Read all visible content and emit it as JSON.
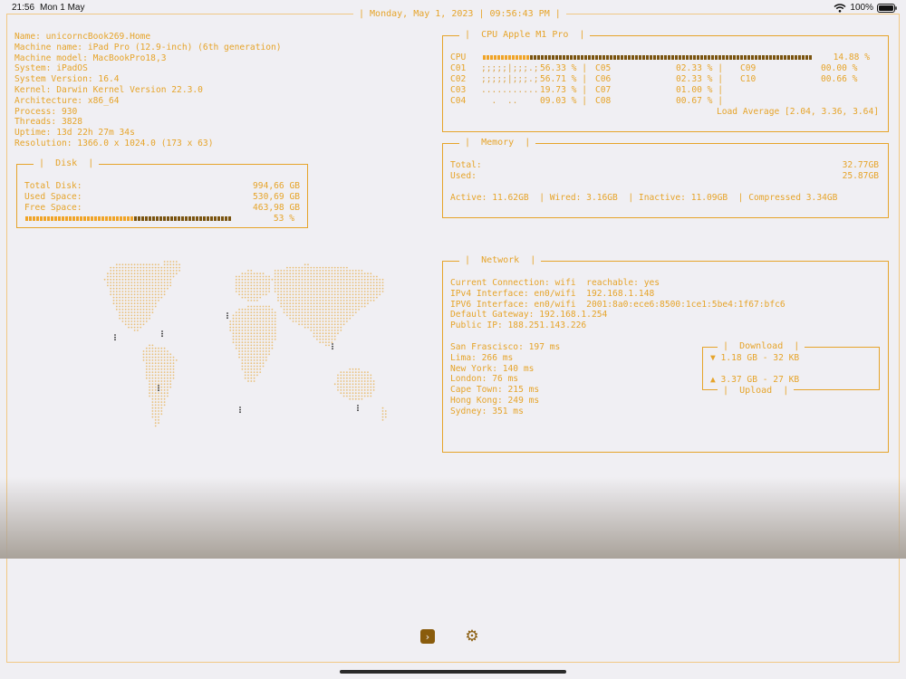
{
  "status_bar": {
    "time": "21:56",
    "date": "Mon 1 May",
    "battery": "100%"
  },
  "top_date": "Monday, May 1, 2023 | 09:56:43 PM",
  "system_info": [
    "Name: unicorncBook269.Home",
    "Machine name: iPad Pro (12.9-inch) (6th generation)",
    "Machine model: MacBookPro18,3",
    "System: iPadOS",
    "System Version: 16.4",
    "Kernel: Darwin Kernel Version 22.3.0",
    "Architecture: x86_64",
    "Process: 930",
    "Threads: 3828",
    "Uptime: 13d 22h 27m 34s",
    "Resolution: 1366.0 x 1024.0 (173 x 63)"
  ],
  "disk": {
    "title": "Disk",
    "total_label": "Total Disk:",
    "total_value": "994,66 GB",
    "used_label": "Used Space:",
    "used_value": "530,69 GB",
    "free_label": "Free Space:",
    "free_value": "463,98 GB",
    "percent_text": "53 %",
    "used_fraction": 0.53
  },
  "cpu": {
    "title": "CPU Apple M1 Pro",
    "total_label": "CPU",
    "total_value": "14.88 %",
    "total_fraction": 0.1488,
    "cores": [
      {
        "label": "C01",
        "spark": ";;;;;|;;;.;",
        "value": "56.33 %"
      },
      {
        "label": "C02",
        "spark": ";;;;;|;;;.;",
        "value": "56.71 %"
      },
      {
        "label": "C03",
        "spark": "...........",
        "value": "19.73 %"
      },
      {
        "label": "C04",
        "spark": "  .  ..     ",
        "value": "09.03 %"
      },
      {
        "label": "C05",
        "value": "02.33 %"
      },
      {
        "label": "C06",
        "value": "02.33 %"
      },
      {
        "label": "C07",
        "value": "01.00 %"
      },
      {
        "label": "C08",
        "value": "00.67 %"
      },
      {
        "label": "C09",
        "value": "00.00 %"
      },
      {
        "label": "C10",
        "value": "00.66 %"
      }
    ],
    "load_average": "Load Average [2.04, 3.36, 3.64]"
  },
  "memory": {
    "title": "Memory",
    "total_label": "Total:",
    "total_value": "32.77GB",
    "used_label": "Used:",
    "used_value": "25.87GB",
    "details": "Active: 11.62GB  | Wired: 3.16GB  | Inactive: 11.09GB  | Compressed 3.34GB"
  },
  "network": {
    "title": "Network",
    "info": [
      "Current Connection: wifi  reachable: yes",
      "IPv4 Interface: en0/wifi  192.168.1.148",
      "IPV6 Interface: en0/wifi  2001:8a0:ece6:8500:1ce1:5be4:1f67:bfc6",
      "Default Gateway: 192.168.1.254",
      "Public IP: 188.251.143.226"
    ],
    "pings": [
      "San Frascisco: 197 ms",
      "Lima: 266 ms",
      "New York: 140 ms",
      "London: 76 ms",
      "Cape Town: 215 ms",
      "Hong Kong: 249 ms",
      "Sydney: 351 ms"
    ],
    "download_title": "Download",
    "upload_title": "Upload",
    "download_value": "▼ 1.18 GB - 32 KB",
    "upload_value": "▲ 3.37 GB - 27 KB"
  },
  "colors": {
    "accent": "#e6a42a",
    "accent_dark": "#8a5c0c",
    "background": "#f0eff3"
  },
  "icons": {
    "terminal": "chevron-right-square-icon",
    "settings": "gear-icon",
    "wifi": "wifi-icon",
    "battery": "battery-icon"
  }
}
